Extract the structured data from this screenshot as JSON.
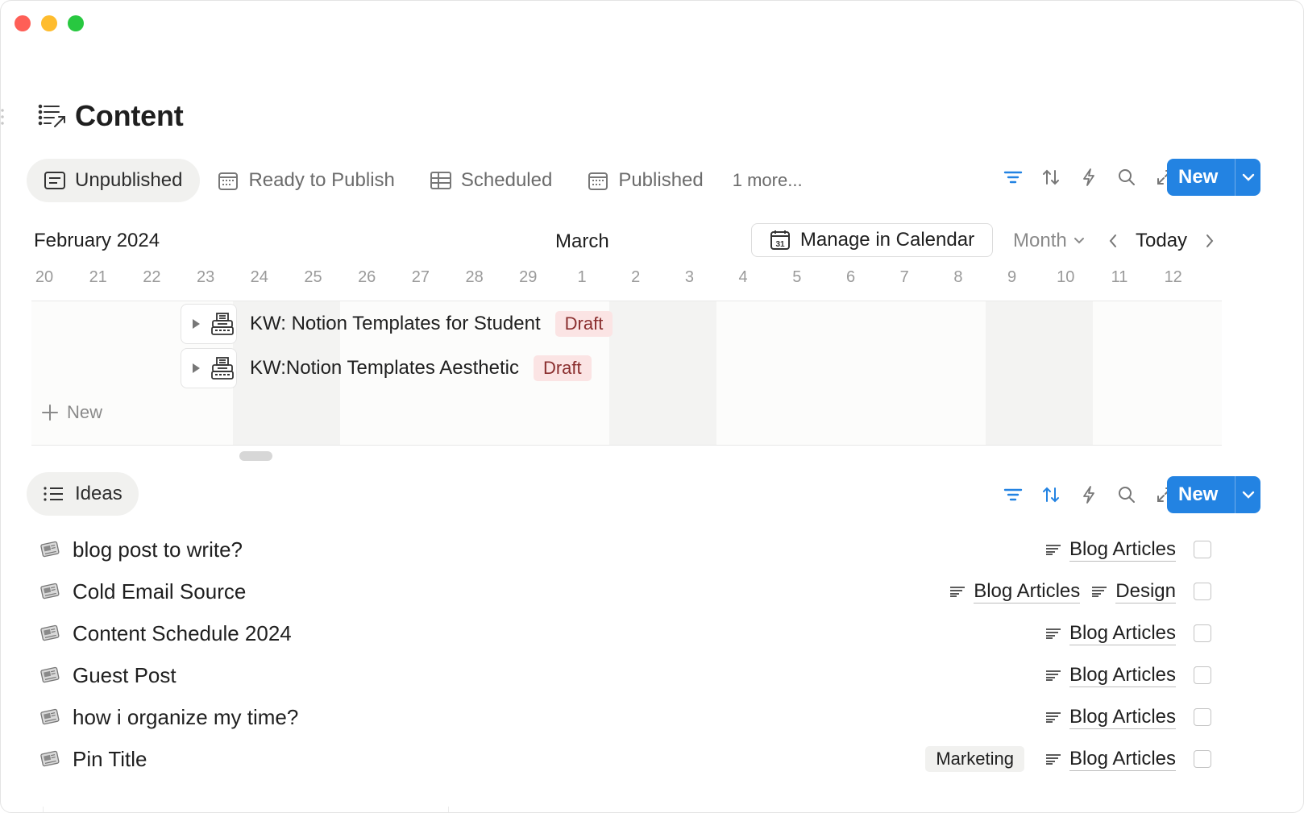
{
  "page": {
    "title": "Content"
  },
  "views": {
    "tabs": [
      {
        "label": "Unpublished",
        "icon": "list-view-icon",
        "active": true
      },
      {
        "label": "Ready to Publish",
        "icon": "calendar-icon",
        "active": false
      },
      {
        "label": "Scheduled",
        "icon": "table-icon",
        "active": false
      },
      {
        "label": "Published",
        "icon": "calendar-icon",
        "active": false
      }
    ],
    "more": "1 more..."
  },
  "toolbar": {
    "new_label": "New"
  },
  "timeline": {
    "month_left": "February 2024",
    "month_mid": "March",
    "manage_label": "Manage in Calendar",
    "calendar_day": "31",
    "range_label": "Month",
    "today_label": "Today",
    "days": [
      "20",
      "21",
      "22",
      "23",
      "24",
      "25",
      "26",
      "27",
      "28",
      "29",
      "1",
      "2",
      "3",
      "4",
      "5",
      "6",
      "7",
      "8",
      "9",
      "10",
      "11",
      "12"
    ],
    "items": [
      {
        "title": "KW: Notion Templates for Student",
        "status": "Draft"
      },
      {
        "title": "KW:Notion Templates Aesthetic",
        "status": "Draft"
      }
    ],
    "new_label": "New"
  },
  "ideas": {
    "tab_label": "Ideas",
    "new_label": "New",
    "rows": [
      {
        "title": "blog post to write?",
        "tags": [
          "Blog Articles"
        ],
        "label": ""
      },
      {
        "title": "Cold Email Source",
        "tags": [
          "Blog Articles",
          "Design"
        ],
        "label": ""
      },
      {
        "title": "Content Schedule 2024",
        "tags": [
          "Blog Articles"
        ],
        "label": ""
      },
      {
        "title": "Guest Post",
        "tags": [
          "Blog Articles"
        ],
        "label": ""
      },
      {
        "title": "how i organize my time?",
        "tags": [
          "Blog Articles"
        ],
        "label": ""
      },
      {
        "title": "Pin Title",
        "tags": [
          "Blog Articles"
        ],
        "label": "Marketing"
      }
    ]
  },
  "colors": {
    "accent": "#2383e2",
    "draft_bg": "#fbe4e4",
    "draft_text": "#8a2e2e"
  }
}
